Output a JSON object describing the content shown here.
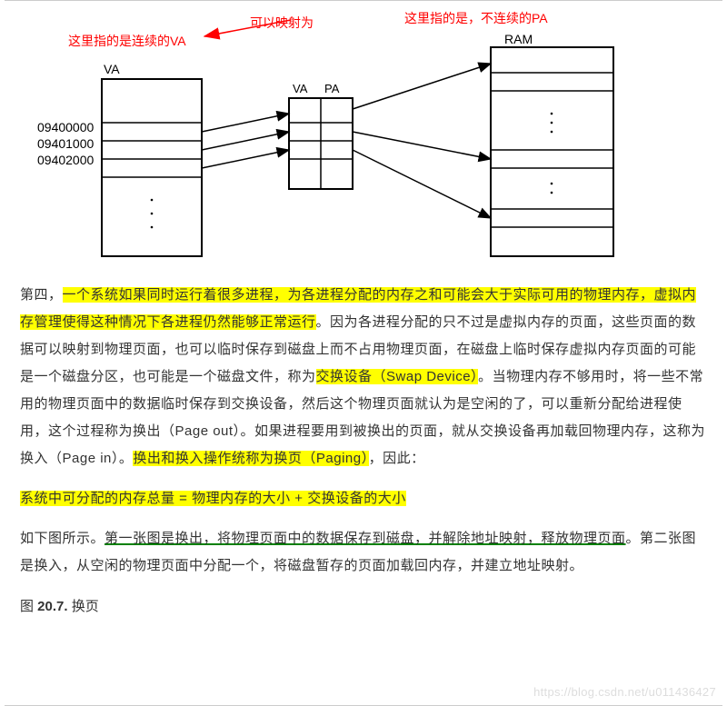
{
  "diagram": {
    "red_left": "这里指的是连续的VA",
    "red_center": "可以映射为",
    "red_right": "这里指的是，不连续的PA",
    "label_ram": "RAM",
    "label_va_top": "VA",
    "label_va_small": "VA",
    "label_pa_small": "PA",
    "addr1": "09400000",
    "addr2": "09401000",
    "addr3": "09402000"
  },
  "para1": {
    "t1": "第四，",
    "h1": "一个系统如果同时运行着很多进程，为各进程分配的内存之和可能会大于实际可用的物理内存，虚拟内存管理使得这种情况下各进程仍然能够正常运行",
    "t2": "。因为各进程分配的只不过是虚拟内存的页面，这些页面的数据可以映射到物理页面，也可以临时保存到磁盘上而不占用物理页面，在磁盘上临时保存虚拟内存页面的可能是一个磁盘分区，也可能是一个磁盘文件，称为",
    "h2": "交换设备（Swap Device）",
    "t3": "。当物理内存不够用时，将一些不常用的物理页面中的数据临时保存到交换设备，然后这个物理页面就认为是空闲的了，可以重新分配给进程使用，这个过程称为换出（Page out）。如果进程要用到被换出的页面，就从交换设备再加载回物理内存，这称为换入（Page in）。",
    "h3": "换出和换入操作统称为换页（Paging）",
    "t4": "，因此："
  },
  "equation": "系统中可分配的内存总量 = 物理内存的大小 + 交换设备的大小",
  "para2": {
    "t1": "如下图所示。",
    "u1": "第一张图是换出，将物理页面中的数据保存到磁盘，并解除地址映射，释放物理页面",
    "t2": "。第二张图是换入，从空闲的物理页面中分配一个，将磁盘暂存的页面加载回内存，并建立地址映射。"
  },
  "caption": {
    "prefix": "图 ",
    "num": "20.7.",
    "title": " 换页"
  },
  "watermark": "https://blog.csdn.net/u011436427"
}
